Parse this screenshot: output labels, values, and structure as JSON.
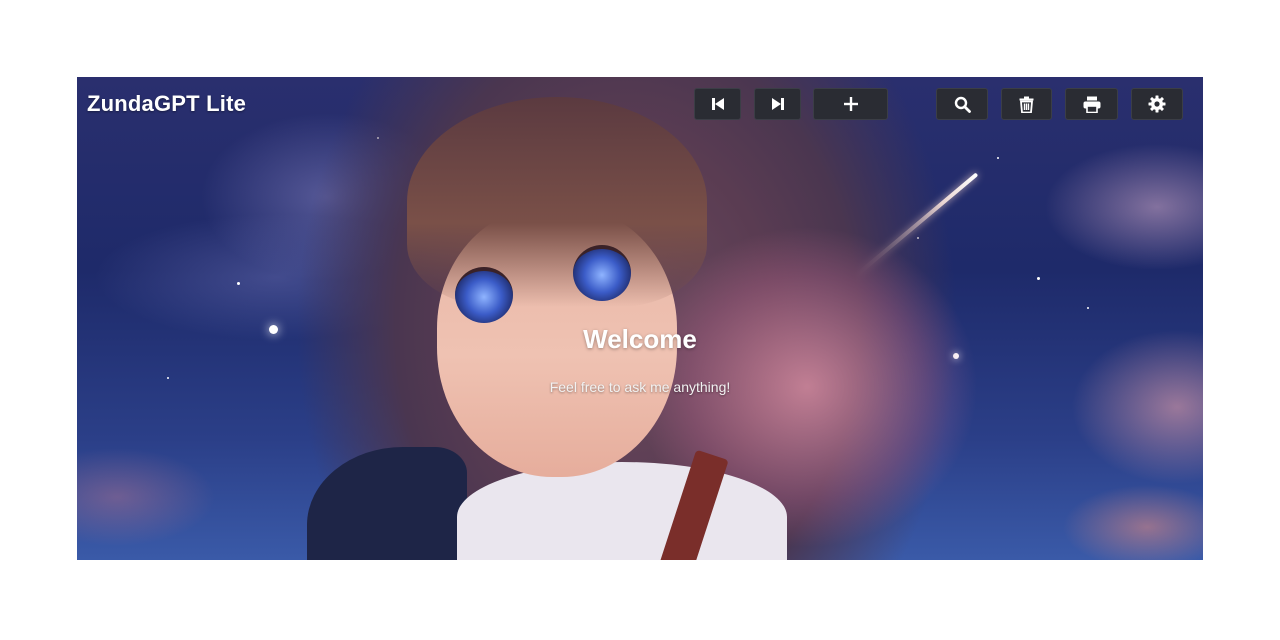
{
  "app": {
    "title": "ZundaGPT Lite"
  },
  "toolbar": {
    "buttons": [
      {
        "icon": "skip-previous-icon"
      },
      {
        "icon": "skip-next-icon"
      },
      {
        "icon": "plus-icon"
      },
      {
        "icon": "search-icon"
      },
      {
        "icon": "trash-icon"
      },
      {
        "icon": "print-icon"
      },
      {
        "icon": "gear-icon"
      }
    ]
  },
  "welcome": {
    "title": "Welcome",
    "subtitle": "Feel free to ask me anything!"
  },
  "colors": {
    "button_bg": "#2a2c33",
    "icon": "#ffffff",
    "page_bg": "#ffffff"
  }
}
